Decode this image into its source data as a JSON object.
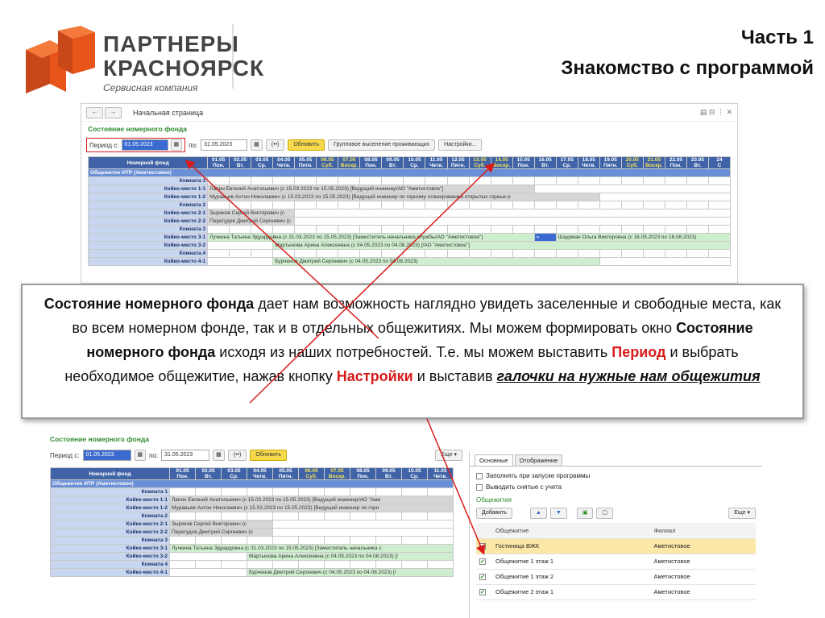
{
  "logo": {
    "line1": "ПАРТНЕРЫ",
    "line2": "КРАСНОЯРСК",
    "line3": "Сервисная компания"
  },
  "title": {
    "line1": "Часть 1",
    "line2": "Знакомство с программой"
  },
  "top": {
    "back": "←",
    "fwd": "→",
    "page_title": "Начальная страница",
    "section": "Состояние номерного фонда",
    "period_label": "Период с:",
    "from": "01.05.2023",
    "to_label": "по:",
    "to": "31.05.2023",
    "ellipsis": "(••)",
    "refresh": "Обновить",
    "group": "Групповое выселение проживающих",
    "settings": "Настройки..."
  },
  "grid_top": {
    "header": "Номерной фонд",
    "days": [
      [
        "01.05",
        "Пон."
      ],
      [
        "02.05",
        "Вт."
      ],
      [
        "03.05",
        "Ср."
      ],
      [
        "04.05",
        "Четв."
      ],
      [
        "05.05",
        "Пятн."
      ],
      [
        "06.05",
        "Суб."
      ],
      [
        "07.05",
        "Воскр."
      ],
      [
        "08.05",
        "Пон."
      ],
      [
        "09.05",
        "Вт."
      ],
      [
        "10.05",
        "Ср."
      ],
      [
        "11.05",
        "Четв."
      ],
      [
        "12.05",
        "Пятн."
      ],
      [
        "13.05",
        "Суб."
      ],
      [
        "14.05",
        "Воскр."
      ],
      [
        "15.05",
        "Пон."
      ],
      [
        "16.05",
        "Вт."
      ],
      [
        "17.05",
        "Ср."
      ],
      [
        "18.05",
        "Четв."
      ],
      [
        "19.05",
        "Пятн."
      ],
      [
        "20.05",
        "Суб."
      ],
      [
        "21.05",
        "Воскр."
      ],
      [
        "22.05",
        "Пон."
      ],
      [
        "23.05",
        "Вт."
      ],
      [
        "24",
        "С"
      ]
    ],
    "group": "Общежитие ИТР (Аметистовое)",
    "rows": [
      {
        "label": "Комната 1",
        "text": ""
      },
      {
        "label": "Койко-место 1-1",
        "text": "Лапин Евгений Анатольевич  (с 15.03.2023 по 15.05.2023) [Ведущий инженер/АО \"Аметистовое\"]"
      },
      {
        "label": "Койко-место 1-2",
        "text": "Муравьев Антон Николаевич  (с 15.03.2023 по 15.05.2023) [Ведущий инженер по горному планированию открытых горных р"
      },
      {
        "label": "Комната 2",
        "text": ""
      },
      {
        "label": "Койко-место 2-1",
        "text": "Зыряков Сергей Викторович  (с"
      },
      {
        "label": "Койко-место 2-2",
        "text": "Перегудов Дмитрий Сергеевич  (с"
      },
      {
        "label": "Комната 3",
        "text": ""
      },
      {
        "label": "Койко-место 3-1",
        "text": "Лучкина Татьяна Эдуардовна  (с 31.03.2023 по 15.05.2023) [Заместитель начальника службы/АО \"Аметистовое\"]",
        "text2": "Шаурман Ольга Викторовна  (с 16.05.2023 по 16.08.2023)"
      },
      {
        "label": "Койко-место 3-2",
        "text": "Мартынова Арина Алексеевна  (с 04.05.2023 по 04.08.2023) [/АО \"Аметистовое\"]"
      },
      {
        "label": "Комната 4",
        "text": ""
      },
      {
        "label": "Койко-место 4-1",
        "text": "Бурченов Дмитрий Сергеевич  (с 04.05.2023 по 04.08.2023)"
      }
    ]
  },
  "callout": {
    "t1": "Состояние номерного фонда",
    "t2": " дает нам возможность наглядно увидеть заселенные и свободные места, как во всем номерном фонде, так и в отдельных общежитиях. Мы можем формировать окно ",
    "t3": "Состояние номерного фонда",
    "t4": " исходя из наших потребностей. Т.е. мы можем выставить ",
    "t5": "Период",
    "t6": " и выбрать необходимое общежитие, нажав кнопку ",
    "t7": "Настройки",
    "t8": " и выставив ",
    "t9": "галочки на нужные нам общежития"
  },
  "bottom": {
    "section": "Состояние номерного фонда",
    "period_label": "Период с:",
    "from": "01.05.2023",
    "to_label": "по:",
    "to": "31.05.2023",
    "ellipsis": "(••)",
    "refresh": "Обновить",
    "more": "Еще ▾",
    "header": "Номерной фонд",
    "days": [
      [
        "01.05",
        "Пон."
      ],
      [
        "02.05",
        "Вт."
      ],
      [
        "03.05",
        "Ср."
      ],
      [
        "04.05",
        "Четв."
      ],
      [
        "05.05",
        "Пятн."
      ],
      [
        "06.05",
        "Суб."
      ],
      [
        "07.05",
        "Воскр."
      ],
      [
        "08.05",
        "Пон."
      ],
      [
        "09.05",
        "Вт."
      ],
      [
        "10.05",
        "Ср."
      ],
      [
        "11.05",
        "Четв."
      ]
    ],
    "group": "Общежитие ИТР (Аметистовое)",
    "rows": [
      {
        "label": "Комната 1",
        "text": ""
      },
      {
        "label": "Койко-место 1-1",
        "text": "Лапин Евгений Анатольевич  (с 15.03.2023 по 15.05.2023) [Ведущий инженер/АО \"Аме"
      },
      {
        "label": "Койко-место 1-2",
        "text": "Муравьев Антон Николаевич  (с 15.03.2023 по 15.05.2023) [Ведущий инженер по горн"
      },
      {
        "label": "Комната 2",
        "text": ""
      },
      {
        "label": "Койко-место 2-1",
        "text": "Зыряков Сергей Викторович  (с"
      },
      {
        "label": "Койко-место 2-2",
        "text": "Перегудов Дмитрий Сергеевич  (с"
      },
      {
        "label": "Комната 3",
        "text": ""
      },
      {
        "label": "Койко-место 3-1",
        "text": "Лучкина Татьяна Эдуардовна  (с 31.03.2023 по 15.05.2023) [Заместитель начальника с"
      },
      {
        "label": "Койко-место 3-2",
        "text": "Мартынова Арина Алексеевна  (с 04.05.2023 по 04.08.2023) [/"
      },
      {
        "label": "Комната 4",
        "text": ""
      },
      {
        "label": "Койко-место 4-1",
        "text": "Бурченов Дмитрий Сергеевич  (с 04.05.2023 по 04.08.2023) [/"
      }
    ],
    "panel": {
      "tab1": "Основные",
      "tab2": "Отображение",
      "opt1": "Заполнять при запуске программы",
      "opt2": "Выводить снятые с учета",
      "section": "Общежития",
      "add": "Добавить",
      "more": "Еще ▾",
      "col1": "Общежитие",
      "col2": "Филиал",
      "rows": [
        {
          "name": "Гостиница ВЖК",
          "branch": "Аметистовое"
        },
        {
          "name": "Общежитие 1 этаж 1",
          "branch": "Аметистовое"
        },
        {
          "name": "Общежитие 1 этаж 2",
          "branch": "Аметистовое"
        },
        {
          "name": "Общежитие 2 этаж 1",
          "branch": "Аметистовое"
        }
      ]
    }
  },
  "colors": {
    "accent": "#d81b1b",
    "header_blue": "#3f63a6",
    "row_label": "#c9d6f0",
    "logo_orange": "#e8551b"
  }
}
